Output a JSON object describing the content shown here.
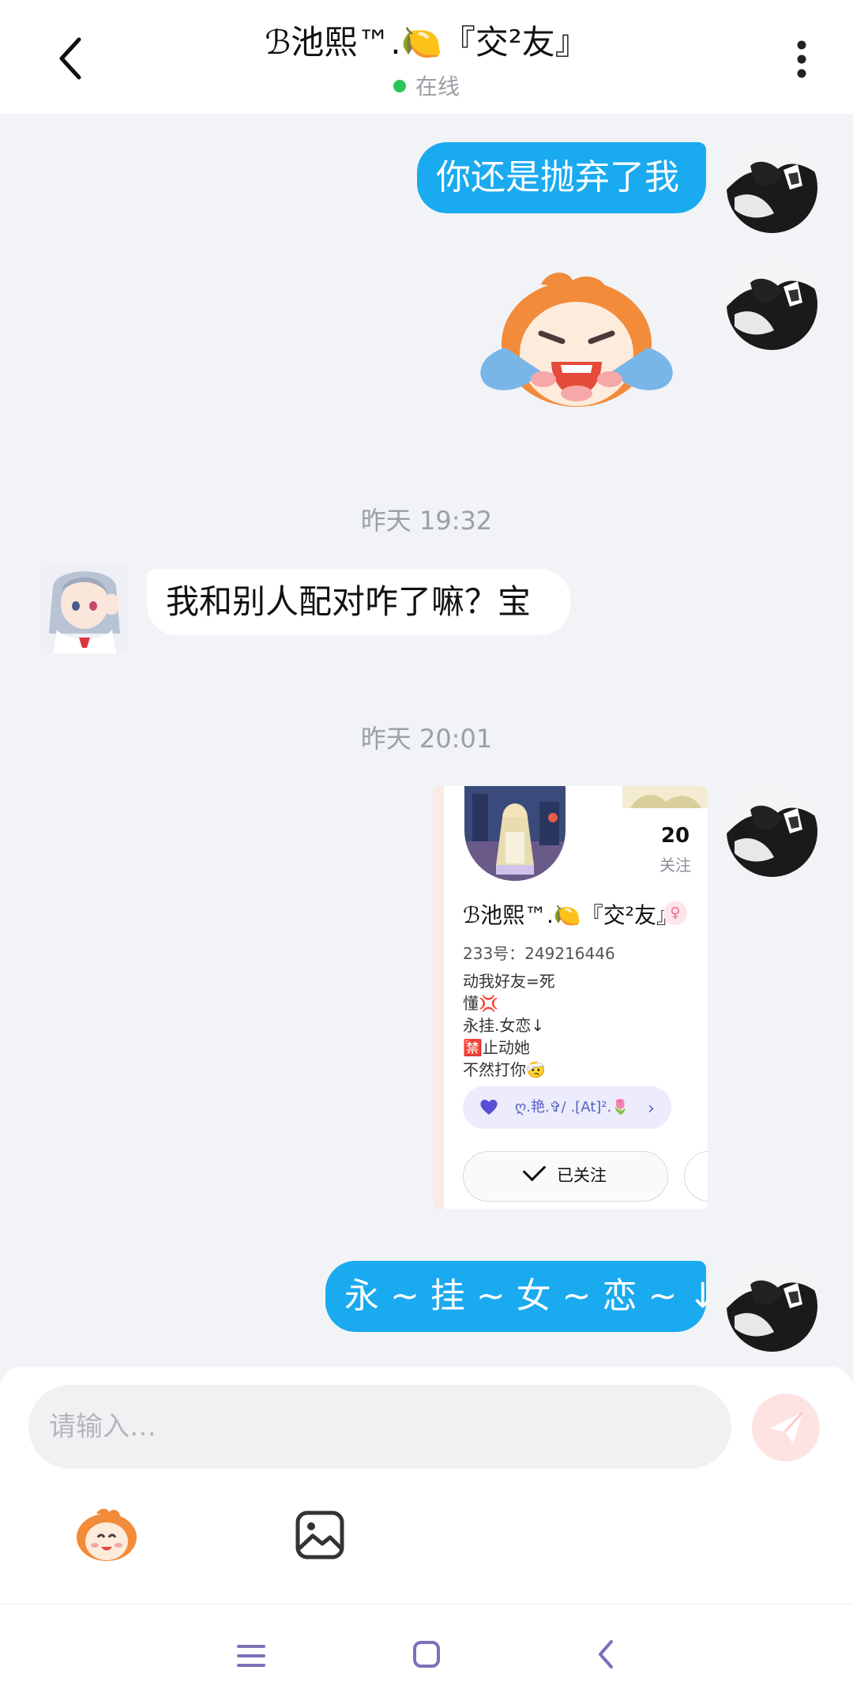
{
  "header": {
    "title": "ℬ池熙™.🍋『交²友』",
    "status": "在线"
  },
  "messages": [
    {
      "type": "text",
      "from": "me",
      "text": "你还是抛弃了我"
    },
    {
      "type": "sticker",
      "from": "me",
      "icon": "crying-monkey-sticker"
    },
    {
      "type": "timestamp",
      "text": "昨天 19:32"
    },
    {
      "type": "text",
      "from": "peer",
      "text": "我和别人配对咋了嘛？宝"
    },
    {
      "type": "timestamp",
      "text": "昨天 20:01"
    },
    {
      "type": "profile_card",
      "from": "me"
    },
    {
      "type": "text",
      "from": "me",
      "text": "永 ~ 挂 ~ 女 ~ 恋 ~ ↓ ~"
    }
  ],
  "profile_card": {
    "name": "ℬ池熙™.🍋『交²友』",
    "gender": "♀",
    "id": "233号：249216446",
    "bio": [
      "动我好友=死",
      "懂💢",
      "永挂.女恋↓",
      "🈲止动她",
      "不然打你🤕"
    ],
    "follow_count": "20",
    "follow_label": "关注",
    "tag": "ღ.艳.✞/ .[At]².🌷",
    "followed_label": "已关注"
  },
  "composer": {
    "placeholder": "请输入…"
  },
  "colors": {
    "bubble_out": "#1aaaf0",
    "background": "#f1f3f7",
    "online": "#2bc45a",
    "send_button": "#fde4e2"
  }
}
